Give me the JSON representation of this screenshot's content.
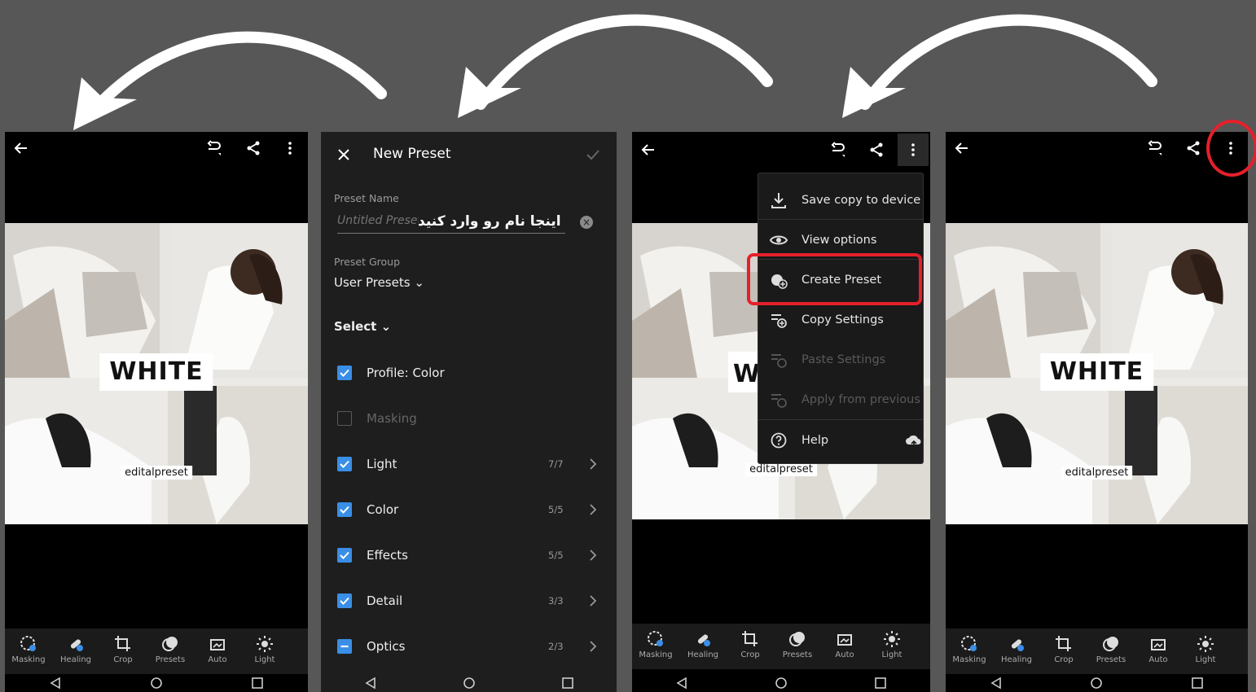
{
  "colors": {
    "background": "#575757",
    "accent_blue": "#3a8ee6",
    "highlight_red": "#e5202b"
  },
  "screen1": {
    "photo_title": "WHITE",
    "photo_caption": "editalpreset",
    "tools": [
      "Masking",
      "Healing",
      "Crop",
      "Presets",
      "Auto",
      "Light"
    ]
  },
  "new_preset": {
    "title": "New Preset",
    "preset_name_label": "Preset Name",
    "preset_name_placeholder": "Untitled Preset",
    "preset_name_annotation": "اینجا نام رو وارد کنید",
    "preset_group_label": "Preset Group",
    "preset_group_value": "User Presets",
    "select_label": "Select",
    "rows": [
      {
        "label": "Profile: Color",
        "checked": true,
        "count": ""
      },
      {
        "label": "Masking",
        "checked": false,
        "count": ""
      },
      {
        "label": "Light",
        "checked": true,
        "count": "7/7"
      },
      {
        "label": "Color",
        "checked": true,
        "count": "5/5"
      },
      {
        "label": "Effects",
        "checked": true,
        "count": "5/5"
      },
      {
        "label": "Detail",
        "checked": true,
        "count": "3/3"
      },
      {
        "label": "Optics",
        "checked": "partial",
        "count": "2/3"
      }
    ]
  },
  "screen3": {
    "photo_caption": "editalpreset",
    "menu": [
      {
        "label": "Save copy to device",
        "icon": "download-icon",
        "enabled": true
      },
      {
        "label": "View options",
        "icon": "eye-icon",
        "enabled": true
      },
      {
        "label": "Create Preset",
        "icon": "create-preset-icon",
        "enabled": true,
        "highlighted": true
      },
      {
        "label": "Copy Settings",
        "icon": "copy-settings-icon",
        "enabled": true
      },
      {
        "label": "Paste Settings",
        "icon": "paste-settings-icon",
        "enabled": false
      },
      {
        "label": "Apply from previous",
        "icon": "apply-previous-icon",
        "enabled": false
      },
      {
        "label": "Help",
        "icon": "help-icon",
        "enabled": true
      }
    ],
    "tools": [
      "Masking",
      "Healing",
      "Crop",
      "Presets",
      "Auto",
      "Light"
    ]
  },
  "screen4": {
    "photo_title": "WHITE",
    "photo_caption": "editalpreset",
    "tools": [
      "Masking",
      "Healing",
      "Crop",
      "Presets",
      "Auto",
      "Light"
    ]
  }
}
